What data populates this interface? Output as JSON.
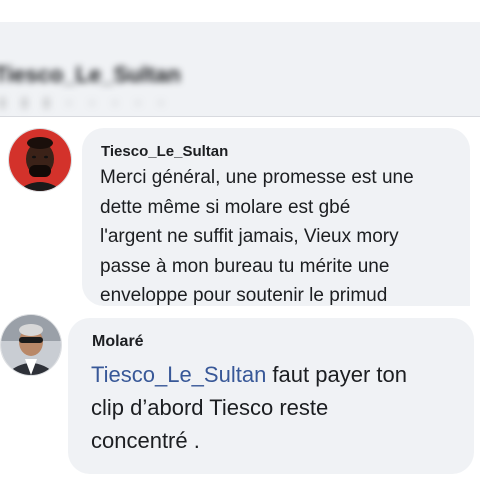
{
  "previous_comment": {
    "author": "Tiesco_Le_Sultan",
    "sub": "ı ı ı · · · · ·"
  },
  "comments": [
    {
      "author": "Tiesco_Le_Sultan",
      "lines": [
        "Merci général, une promesse est une",
        "dette même si molare est gbé",
        "l'argent ne suffit jamais,  Vieux mory",
        "passe à mon bureau tu mérite une",
        "enveloppe pour soutenir le primud"
      ]
    },
    {
      "author": "Molaré",
      "mention": "Tiesco_Le_Sultan",
      "line1_rest": " faut payer ton",
      "line2": "clip d’abord Tiesco reste",
      "line3": "concentré ."
    }
  ],
  "colors": {
    "bubble": "#f0f2f5",
    "mention": "#385898",
    "text": "#1c1e21"
  }
}
